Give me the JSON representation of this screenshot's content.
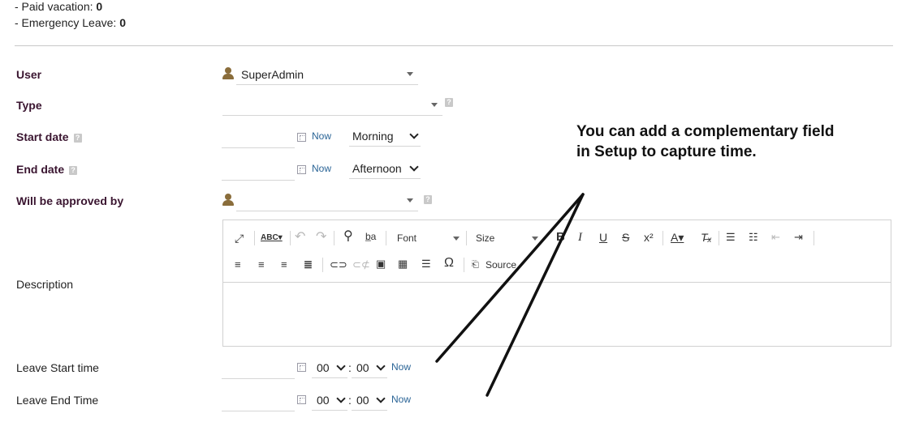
{
  "balances": {
    "paid_vacation_label": "- Paid vacation:",
    "paid_vacation_value": "0",
    "emergency_leave_label": "- Emergency Leave:",
    "emergency_leave_value": "0"
  },
  "form": {
    "user": {
      "label": "User",
      "value": "SuperAdmin",
      "icon": "user-icon"
    },
    "type": {
      "label": "Type",
      "value": ""
    },
    "start_date": {
      "label": "Start date",
      "now": "Now",
      "period": "Morning"
    },
    "end_date": {
      "label": "End date",
      "now": "Now",
      "period": "Afternoon"
    },
    "approver": {
      "label": "Will be approved by",
      "value": ""
    },
    "description": {
      "label": "Description"
    },
    "leave_start": {
      "label": "Leave Start time",
      "hour": "00",
      "minute": "00",
      "sep": ":",
      "now": "Now"
    },
    "leave_end": {
      "label": "Leave End Time",
      "hour": "00",
      "minute": "00",
      "sep": ":",
      "now": "Now"
    },
    "help_glyph": "?"
  },
  "editor": {
    "font_label": "Font",
    "size_label": "Size",
    "source_label": "Source",
    "tools_row1": [
      "maximize-icon",
      "spellcheck-icon",
      "undo-icon",
      "redo-icon",
      "find-icon",
      "replace-icon",
      "bold-icon",
      "italic-icon",
      "underline-icon",
      "strike-icon",
      "superscript-icon",
      "text-color-icon",
      "remove-format-icon",
      "numbered-list-icon",
      "bulleted-list-icon",
      "outdent-icon",
      "indent-icon"
    ],
    "tools_row2": [
      "align-left-icon",
      "align-center-icon",
      "align-right-icon",
      "justify-icon",
      "link-icon",
      "unlink-icon",
      "image-icon",
      "table-icon",
      "horizontal-rule-icon",
      "special-char-icon",
      "source-icon"
    ]
  },
  "annotation": {
    "line1": "You can add a complementary field",
    "line2": "in Setup to capture time."
  },
  "colors": {
    "required_label": "#3a1530",
    "link": "#2a6496",
    "user_icon": "#8a6d3b"
  }
}
